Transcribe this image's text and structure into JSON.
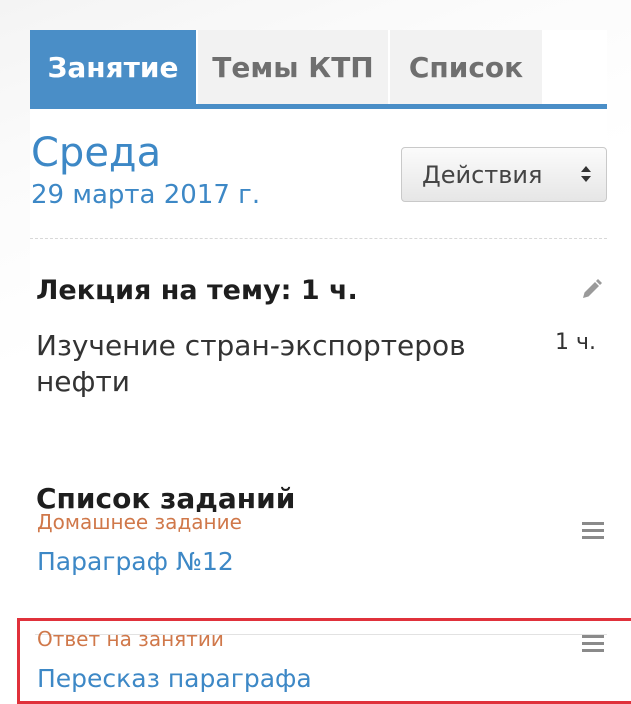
{
  "tabs": [
    {
      "label": "Занятие",
      "active": true
    },
    {
      "label": "Темы КТП",
      "active": false
    },
    {
      "label": "Список",
      "active": false
    }
  ],
  "header": {
    "day": "Среда",
    "date": "29 марта 2017 г.",
    "actions_label": "Действия"
  },
  "lecture": {
    "title": "Лекция на тему: 1 ч.",
    "topic": "Изучение стран-экспортеров нефти",
    "hours": "1 ч."
  },
  "tasks": {
    "title": "Список заданий",
    "items": [
      {
        "type": "Домашнее задание",
        "name": "Параграф №12"
      },
      {
        "type": "Ответ на занятии",
        "name": "Пересказ параграфа"
      }
    ]
  },
  "colors": {
    "accent": "#4a8ec7",
    "link": "#3d88c6",
    "task_type": "#d0784a",
    "highlight": "#e0313b"
  },
  "icons": {
    "edit": "pencil-icon",
    "menu": "hamburger-icon",
    "select": "sort-caret-icon"
  }
}
